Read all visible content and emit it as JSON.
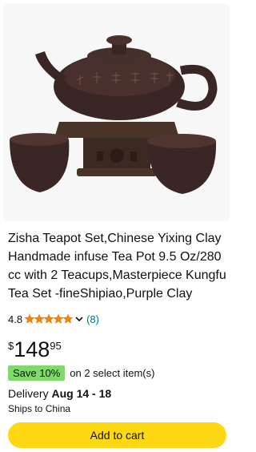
{
  "product": {
    "title": "Zisha Teapot Set,Chinese Yixing Clay Handmade infuse Tea Pot 9.5 Oz/280 cc with 2 Teacups,Masterpiece Kungfu Tea Set -fineShipiao,Purple Clay",
    "image_icon": "teapot-product-photo",
    "rating": {
      "value": "4.8",
      "stars": 4.8,
      "max_stars": 5,
      "star_color": "#f08804",
      "review_count": "(8)"
    },
    "price": {
      "symbol": "$",
      "whole": "148",
      "fraction": "95"
    },
    "savings": {
      "badge": "Save 10%",
      "badge_color": "#7fda69",
      "text": "on 2 select item(s)"
    },
    "delivery": {
      "label": "Delivery",
      "date": "Aug 14 - 18"
    },
    "ships_to": "Ships to China",
    "add_to_cart_label": "Add to cart",
    "button_color": "#ffd814"
  }
}
